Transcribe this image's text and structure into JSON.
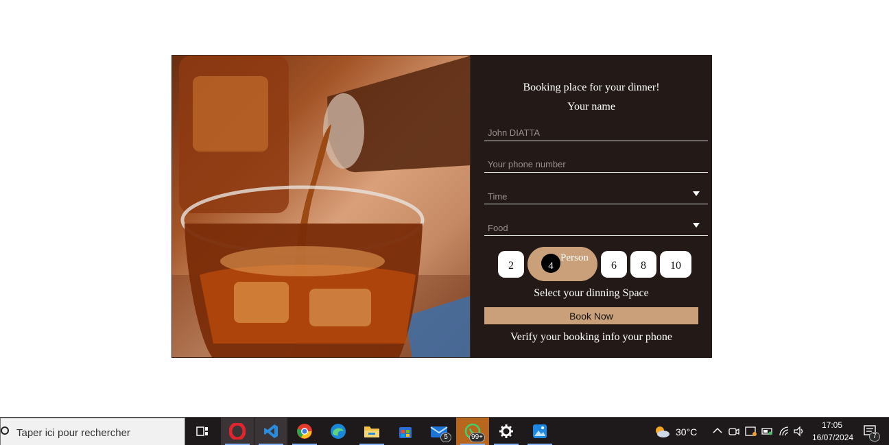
{
  "form": {
    "title": "Booking place for your dinner!",
    "subtitle": "Your name",
    "name_placeholder": "John DIATTA",
    "phone_placeholder": "Your phone number",
    "time_label": "Time",
    "food_label": "Food",
    "persons": [
      "2",
      "4",
      "6",
      "8",
      "10"
    ],
    "selected_person": "4",
    "person_label": "Person",
    "space_label": "Select your dinning Space",
    "book_button": "Book Now",
    "verify_text": "Verify your booking info your phone"
  },
  "colors": {
    "panel": "#231a17",
    "accent": "#caa07a"
  },
  "taskbar": {
    "search_placeholder": "Taper ici pour rechercher",
    "mail_badge": "5",
    "whatsapp_badge": "99+",
    "weather": "30°C",
    "time": "17:05",
    "date": "16/07/2024",
    "notification_count": "7"
  }
}
